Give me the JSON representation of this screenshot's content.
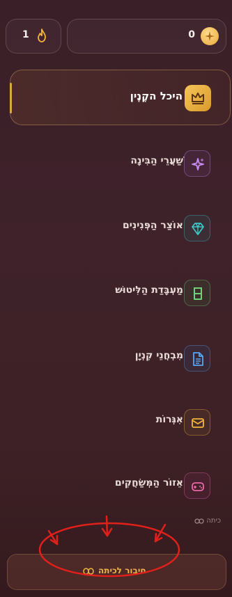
{
  "stats": {
    "streak": "1",
    "points": "0"
  },
  "nav": {
    "items": [
      {
        "label": "היכל הקֶנֶין",
        "icon": "crown-icon",
        "color": "#f2b63c",
        "active": true
      },
      {
        "label": "שַׁעֲרֵי הַבִּינָה",
        "icon": "sparkles-icon",
        "color": "#c98cf2"
      },
      {
        "label": "אוֹצַר הַפְּנִינִים",
        "icon": "diamond-icon",
        "color": "#3cc7c7"
      },
      {
        "label": "מַעְבָּדַת הַלִּיטוּשׁ",
        "icon": "beaker-icon",
        "color": "#6fd17a"
      },
      {
        "label": "מִבְחֲנֵי קִנְיָן",
        "icon": "document-icon",
        "color": "#5aa6f0"
      },
      {
        "label": "אִגְּרוֹת",
        "icon": "envelope-icon",
        "color": "#f2b63c"
      },
      {
        "label": "אֵזוֹר הַמְּשַׂחֲקִים",
        "icon": "gamepad-icon",
        "color": "#e96aa8"
      }
    ]
  },
  "classroom": {
    "status_label": "כיתה",
    "join_button_label": "חיבור לכיתה"
  },
  "colors": {
    "accent": "#e0a83a",
    "background": "#3d2127",
    "annotation": "#e0201a"
  }
}
